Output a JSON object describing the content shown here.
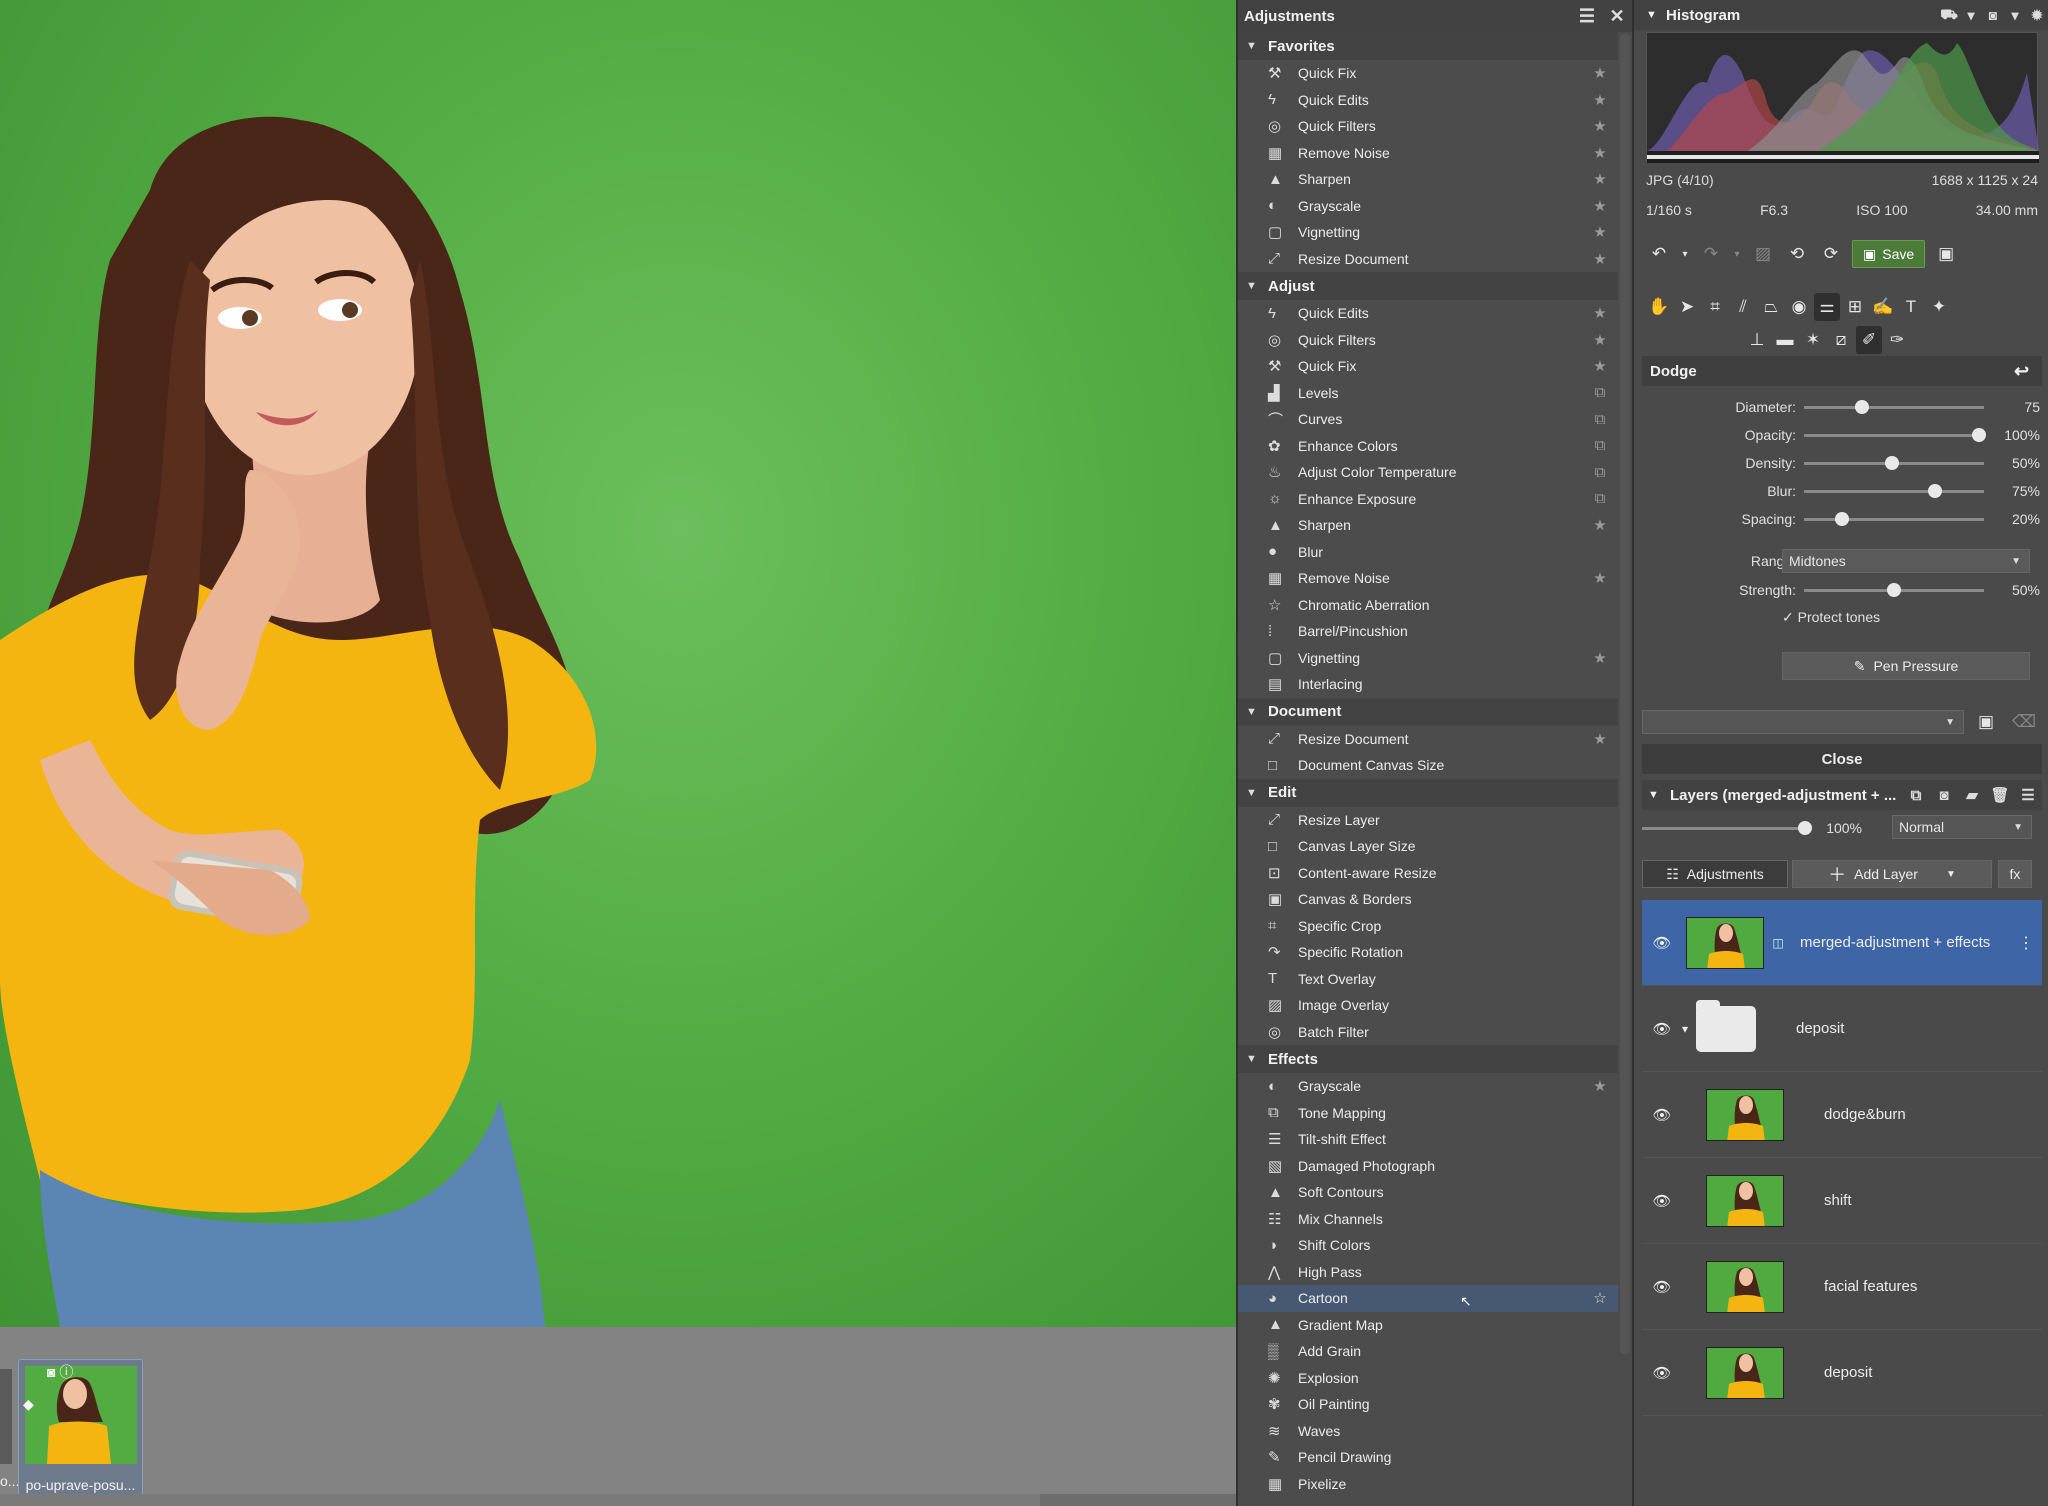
{
  "adjustments_panel": {
    "title": "Adjustments",
    "sections": [
      {
        "name": "Favorites",
        "items": [
          {
            "label": "Quick Fix",
            "icon": "quick-fix-icon",
            "glyph": "⚒",
            "right": "★"
          },
          {
            "label": "Quick Edits",
            "icon": "lightning-icon",
            "glyph": "ϟ",
            "right": "★"
          },
          {
            "label": "Quick Filters",
            "icon": "filters-icon",
            "glyph": "◎",
            "right": "★"
          },
          {
            "label": "Remove Noise",
            "icon": "noise-icon",
            "glyph": "▦",
            "right": "★"
          },
          {
            "label": "Sharpen",
            "icon": "sharpen-icon",
            "glyph": "▲",
            "right": "★"
          },
          {
            "label": "Grayscale",
            "icon": "grayscale-icon",
            "glyph": "◐",
            "right": "★"
          },
          {
            "label": "Vignetting",
            "icon": "vignetting-icon",
            "glyph": "▢",
            "right": "★"
          },
          {
            "label": "Resize Document",
            "icon": "resize-icon",
            "glyph": "⤢",
            "right": "★"
          }
        ]
      },
      {
        "name": "Adjust",
        "items": [
          {
            "label": "Quick Edits",
            "icon": "lightning-icon",
            "glyph": "ϟ",
            "right": "★"
          },
          {
            "label": "Quick Filters",
            "icon": "filters-icon",
            "glyph": "◎",
            "right": "★"
          },
          {
            "label": "Quick Fix",
            "icon": "quick-fix-icon",
            "glyph": "⚒",
            "right": "★"
          },
          {
            "label": "Levels",
            "icon": "levels-icon",
            "glyph": "▟",
            "right": "⧉"
          },
          {
            "label": "Curves",
            "icon": "curves-icon",
            "glyph": "⌒",
            "right": "⧉"
          },
          {
            "label": "Enhance Colors",
            "icon": "palette-icon",
            "glyph": "✿",
            "right": "⧉"
          },
          {
            "label": "Adjust Color Temperature",
            "icon": "bulb-icon",
            "glyph": "♨",
            "right": "⧉"
          },
          {
            "label": "Enhance Exposure",
            "icon": "sun-icon",
            "glyph": "☼",
            "right": "⧉"
          },
          {
            "label": "Sharpen",
            "icon": "sharpen-icon",
            "glyph": "▲",
            "right": "★"
          },
          {
            "label": "Blur",
            "icon": "drop-icon",
            "glyph": "●",
            "right": ""
          },
          {
            "label": "Remove Noise",
            "icon": "noise-icon",
            "glyph": "▦",
            "right": "★"
          },
          {
            "label": "Chromatic Aberration",
            "icon": "star-outline-icon",
            "glyph": "☆",
            "right": ""
          },
          {
            "label": "Barrel/Pincushion",
            "icon": "grid-dots-icon",
            "glyph": "⁞",
            "right": ""
          },
          {
            "label": "Vignetting",
            "icon": "vignetting-icon",
            "glyph": "▢",
            "right": "★"
          },
          {
            "label": "Interlacing",
            "icon": "interlace-icon",
            "glyph": "▤",
            "right": ""
          }
        ]
      },
      {
        "name": "Document",
        "items": [
          {
            "label": "Resize Document",
            "icon": "resize-icon",
            "glyph": "⤢",
            "right": "★"
          },
          {
            "label": "Document Canvas Size",
            "icon": "canvas-icon",
            "glyph": "□",
            "right": ""
          }
        ]
      },
      {
        "name": "Edit",
        "items": [
          {
            "label": "Resize Layer",
            "icon": "resize-icon",
            "glyph": "⤢",
            "right": ""
          },
          {
            "label": "Canvas Layer Size",
            "icon": "canvas-icon",
            "glyph": "□",
            "right": ""
          },
          {
            "label": "Content-aware Resize",
            "icon": "content-aware-icon",
            "glyph": "⊡",
            "right": ""
          },
          {
            "label": "Canvas & Borders",
            "icon": "borders-icon",
            "glyph": "▣",
            "right": ""
          },
          {
            "label": "Specific Crop",
            "icon": "crop-icon",
            "glyph": "⌗",
            "right": ""
          },
          {
            "label": "Specific Rotation",
            "icon": "rotate-icon",
            "glyph": "↷",
            "right": ""
          },
          {
            "label": "Text Overlay",
            "icon": "text-icon",
            "glyph": "T",
            "right": ""
          },
          {
            "label": "Image Overlay",
            "icon": "image-icon",
            "glyph": "▨",
            "right": ""
          },
          {
            "label": "Batch Filter",
            "icon": "batch-icon",
            "glyph": "◎",
            "right": ""
          }
        ]
      },
      {
        "name": "Effects",
        "items": [
          {
            "label": "Grayscale",
            "icon": "grayscale-icon",
            "glyph": "◐",
            "right": "★"
          },
          {
            "label": "Tone Mapping",
            "icon": "tone-mapping-icon",
            "glyph": "⧉",
            "right": ""
          },
          {
            "label": "Tilt-shift Effect",
            "icon": "tilt-shift-icon",
            "glyph": "☰",
            "right": ""
          },
          {
            "label": "Damaged Photograph",
            "icon": "damaged-photo-icon",
            "glyph": "▧",
            "right": ""
          },
          {
            "label": "Soft Contours",
            "icon": "soft-contours-icon",
            "glyph": "▲",
            "right": ""
          },
          {
            "label": "Mix Channels",
            "icon": "mix-channels-icon",
            "glyph": "☷",
            "right": ""
          },
          {
            "label": "Shift Colors",
            "icon": "shift-colors-icon",
            "glyph": "◑",
            "right": ""
          },
          {
            "label": "High Pass",
            "icon": "high-pass-icon",
            "glyph": "⋀",
            "right": ""
          },
          {
            "label": "Cartoon",
            "icon": "cartoon-icon",
            "glyph": "◕",
            "right": "☆",
            "selected": true
          },
          {
            "label": "Gradient Map",
            "icon": "gradient-map-icon",
            "glyph": "▲",
            "right": ""
          },
          {
            "label": "Add Grain",
            "icon": "grain-icon",
            "glyph": "▒",
            "right": ""
          },
          {
            "label": "Explosion",
            "icon": "explosion-icon",
            "glyph": "✺",
            "right": ""
          },
          {
            "label": "Oil Painting",
            "icon": "oil-painting-icon",
            "glyph": "✾",
            "right": ""
          },
          {
            "label": "Waves",
            "icon": "waves-icon",
            "glyph": "≋",
            "right": ""
          },
          {
            "label": "Pencil Drawing",
            "icon": "pencil-icon",
            "glyph": "✎",
            "right": ""
          },
          {
            "label": "Pixelize",
            "icon": "pixelize-icon",
            "glyph": "▦",
            "right": ""
          }
        ]
      }
    ]
  },
  "histogram": {
    "title": "Histogram",
    "format": "JPG",
    "index": "(4/10)",
    "dimensions": "1688 x 1125 x 24",
    "shutter": "1/160 s",
    "aperture": "F6.3",
    "iso": "ISO 100",
    "focal": "34.00 mm"
  },
  "toolbar": {
    "save_label": "Save"
  },
  "dodge": {
    "title": "Dodge",
    "sliders": [
      {
        "label": "Diameter:",
        "value": "75",
        "level": 0.32
      },
      {
        "label": "Opacity:",
        "value": "100%",
        "level": 0.97
      },
      {
        "label": "Density:",
        "value": "50%",
        "level": 0.49
      },
      {
        "label": "Blur:",
        "value": "75%",
        "level": 0.73
      },
      {
        "label": "Spacing:",
        "value": "20%",
        "level": 0.21
      }
    ],
    "range_label": "Range:",
    "range_value": "Midtones",
    "strength_label": "Strength:",
    "strength_value": "50%",
    "strength_level": 0.5,
    "protect_tones": "Protect tones",
    "pen_pressure": "Pen Pressure",
    "close": "Close"
  },
  "layers": {
    "title": "Layers (merged-adjustment + ...",
    "opacity": "100%",
    "opacity_level": 0.98,
    "blend_mode": "Normal",
    "adjustments_button": "Adjustments",
    "add_layer_button": "Add Layer",
    "fx_button": "fx",
    "items": [
      {
        "name": "merged-adjustment + effects",
        "selected": true
      },
      {
        "name": "deposit",
        "folder": true
      },
      {
        "name": "dodge&burn"
      },
      {
        "name": "shift"
      },
      {
        "name": "facial features"
      },
      {
        "name": "deposit"
      }
    ]
  },
  "filmstrip": {
    "thumbnail_label": "po-uprave-posu...",
    "left_label": "o..."
  }
}
